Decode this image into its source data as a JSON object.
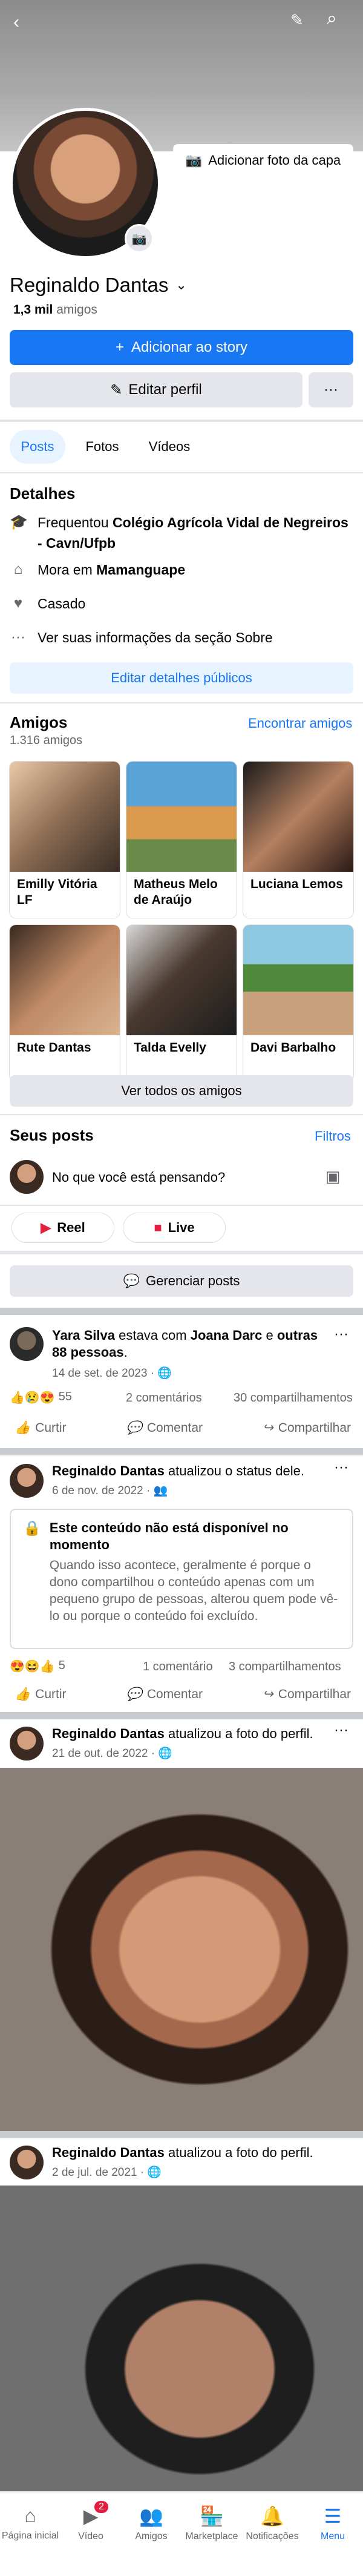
{
  "profile": {
    "name": "Reginaldo Dantas",
    "friends_count": "1,3 mil",
    "friends_word": "amigos",
    "cover_button": "Adicionar foto da capa",
    "add_story": "Adicionar ao story",
    "edit_profile": "Editar perfil",
    "more": "···"
  },
  "tabs": [
    "Posts",
    "Fotos",
    "Vídeos"
  ],
  "details": {
    "title": "Detalhes",
    "studied_prefix": "Frequentou",
    "studied_place": "Colégio Agrícola Vidal de Negreiros - Cavn/Ufpb",
    "lives_prefix": "Mora em",
    "lives_place": "Mamanguape",
    "relationship": "Casado",
    "see_about": "Ver suas informações da seção Sobre",
    "edit_button": "Editar detalhes públicos"
  },
  "friends": {
    "title": "Amigos",
    "count": "1.316 amigos",
    "find": "Encontrar amigos",
    "list": [
      "Emilly Vitória LF",
      "Matheus Melo de Araújo",
      "Luciana Lemos",
      "Rute Dantas",
      "Talda Evelly",
      "Davi Barbalho"
    ],
    "see_all": "Ver todos os amigos"
  },
  "your_posts": {
    "title": "Seus posts",
    "filters": "Filtros",
    "composer_placeholder": "No que você está pensando?",
    "reel": "Reel",
    "live": "Live",
    "manage": "Gerenciar posts"
  },
  "posts": [
    {
      "author": "Yara Silva",
      "with_text": "estava com",
      "with_name": "Joana Darc",
      "and_text": "e",
      "others": "outras 88 pessoas",
      "date": "14 de set. de 2023 · 🌐",
      "reactions": "55",
      "comments": "2 comentários",
      "shares": "30 compartilhamentos"
    },
    {
      "author": "Reginaldo Dantas",
      "action": "atualizou o status dele.",
      "date": "6 de nov. de 2022 · 👥",
      "unavailable_title": "Este conteúdo não está disponível no momento",
      "unavailable_body": "Quando isso acontece, geralmente é porque o dono compartilhou o conteúdo apenas com um pequeno grupo de pessoas, alterou quem pode vê-lo ou porque o conteúdo foi excluído.",
      "reactions": "5",
      "comments": "1 comentário",
      "shares": "3 compartilhamentos"
    },
    {
      "author": "Reginaldo Dantas",
      "action": "atualizou a foto do perfil.",
      "date": "21 de out. de 2022 · 🌐"
    },
    {
      "author": "Reginaldo Dantas",
      "action": "atualizou a foto do perfil.",
      "date": "2 de jul. de 2021 · 🌐"
    }
  ],
  "post_actions": {
    "like": "Curtir",
    "comment": "Comentar",
    "share": "Compartilhar"
  },
  "bottom_nav": [
    "Página inicial",
    "Vídeo",
    "Amigos",
    "Marketplace",
    "Notificações",
    "Menu"
  ],
  "video_badge": "2",
  "colors": {
    "accent": "#1877f2",
    "badge": "#e41e3f"
  }
}
